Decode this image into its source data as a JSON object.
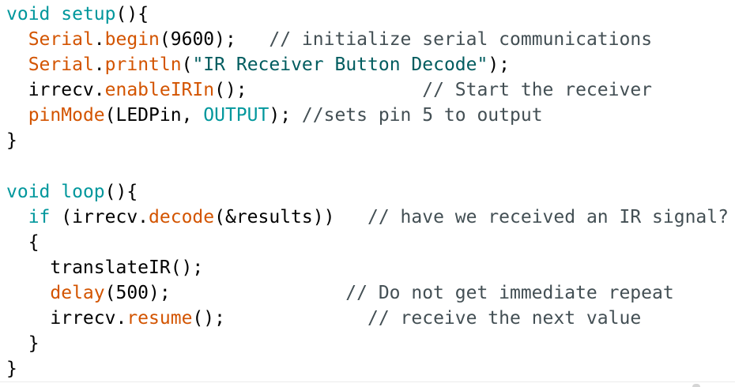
{
  "code": {
    "lines": [
      [
        {
          "t": "void",
          "c": "k"
        },
        {
          "t": " ",
          "c": "t"
        },
        {
          "t": "setup",
          "c": "k"
        },
        {
          "t": "(){",
          "c": "t"
        }
      ],
      [
        {
          "t": "  ",
          "c": "t"
        },
        {
          "t": "Serial",
          "c": "f"
        },
        {
          "t": ".",
          "c": "t"
        },
        {
          "t": "begin",
          "c": "f"
        },
        {
          "t": "(9600);   ",
          "c": "t"
        },
        {
          "t": "// initialize serial communications",
          "c": "c"
        }
      ],
      [
        {
          "t": "  ",
          "c": "t"
        },
        {
          "t": "Serial",
          "c": "f"
        },
        {
          "t": ".",
          "c": "t"
        },
        {
          "t": "println",
          "c": "f"
        },
        {
          "t": "(",
          "c": "t"
        },
        {
          "t": "\"IR Receiver Button Decode\"",
          "c": "s"
        },
        {
          "t": ");",
          "c": "t"
        }
      ],
      [
        {
          "t": "  irrecv.",
          "c": "t"
        },
        {
          "t": "enableIRIn",
          "c": "f"
        },
        {
          "t": "();                ",
          "c": "t"
        },
        {
          "t": "// Start the receiver",
          "c": "c"
        }
      ],
      [
        {
          "t": "  ",
          "c": "t"
        },
        {
          "t": "pinMode",
          "c": "f"
        },
        {
          "t": "(LEDPin, ",
          "c": "t"
        },
        {
          "t": "OUTPUT",
          "c": "k"
        },
        {
          "t": "); ",
          "c": "t"
        },
        {
          "t": "//sets pin 5 to output",
          "c": "c"
        }
      ],
      [
        {
          "t": "}",
          "c": "t"
        }
      ],
      [],
      [
        {
          "t": "void",
          "c": "k"
        },
        {
          "t": " ",
          "c": "t"
        },
        {
          "t": "loop",
          "c": "k"
        },
        {
          "t": "(){",
          "c": "t"
        }
      ],
      [
        {
          "t": "  ",
          "c": "t"
        },
        {
          "t": "if",
          "c": "k"
        },
        {
          "t": " (irrecv.",
          "c": "t"
        },
        {
          "t": "decode",
          "c": "f"
        },
        {
          "t": "(&results))   ",
          "c": "t"
        },
        {
          "t": "// have we received an IR signal?",
          "c": "c"
        }
      ],
      [
        {
          "t": "  {",
          "c": "t"
        }
      ],
      [
        {
          "t": "    translateIR();",
          "c": "t"
        }
      ],
      [
        {
          "t": "    ",
          "c": "t"
        },
        {
          "t": "delay",
          "c": "f"
        },
        {
          "t": "(500);                ",
          "c": "t"
        },
        {
          "t": "// Do not get immediate repeat",
          "c": "c"
        }
      ],
      [
        {
          "t": "    irrecv.",
          "c": "t"
        },
        {
          "t": "resume",
          "c": "f"
        },
        {
          "t": "();             ",
          "c": "t"
        },
        {
          "t": "// receive the next value",
          "c": "c"
        }
      ],
      [
        {
          "t": "  }",
          "c": "t"
        }
      ],
      [
        {
          "t": "}",
          "c": "t"
        }
      ]
    ]
  },
  "colors": {
    "keyword": "#00979C",
    "function": "#D35400",
    "comment": "#434F54",
    "string": "#005C5F",
    "background": "#ffffff"
  }
}
